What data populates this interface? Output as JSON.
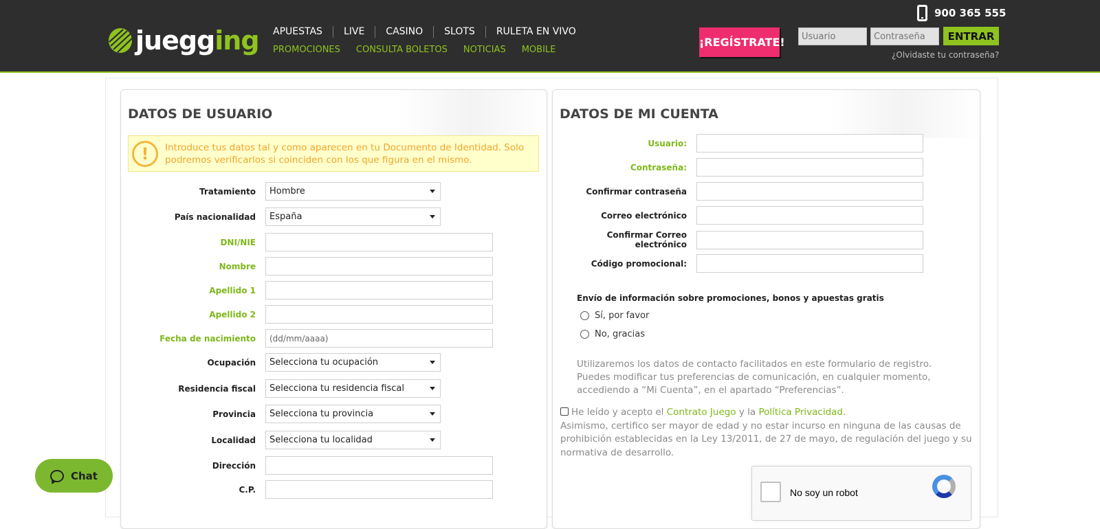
{
  "header": {
    "logo_text_start": "juegg",
    "logo_text_mid": "ing",
    "nav_main": [
      "APUESTAS",
      "LIVE",
      "CASINO",
      "SLOTS",
      "RULETA EN VIVO"
    ],
    "nav_sub": [
      "PROMOCIONES",
      "CONSULTA BOLETOS",
      "NOTICIAS",
      "MOBILE"
    ],
    "register_label": "¡REGÍSTRATE!",
    "phone": "900 365 555",
    "login_user_placeholder": "Usuario",
    "login_pass_placeholder": "Contraseña",
    "login_button": "ENTRAR",
    "forgot_password": "¿Olvidaste tu contraseña?"
  },
  "user_panel": {
    "title": "DATOS DE USUARIO",
    "notice": "Introduce tus datos tal y como aparecen en tu Documento de Identidad. Solo podremos verificarlos si coinciden con los que figura en el mismo.",
    "fields": {
      "treatment": {
        "label": "Tratamiento",
        "value": "Hombre"
      },
      "nationality": {
        "label": "País nacionalidad",
        "value": "España"
      },
      "dni": {
        "label": "DNI/NIE",
        "value": ""
      },
      "name": {
        "label": "Nombre",
        "value": ""
      },
      "surname1": {
        "label": "Apellido 1",
        "value": ""
      },
      "surname2": {
        "label": "Apellido 2",
        "value": ""
      },
      "birthdate": {
        "label": "Fecha de nacimiento",
        "placeholder": "(dd/mm/aaaa)"
      },
      "occupation": {
        "label": "Ocupación",
        "value": "Selecciona tu ocupación"
      },
      "tax_residence": {
        "label": "Residencia fiscal",
        "value": "Selecciona tu residencia fiscal"
      },
      "province": {
        "label": "Provincia",
        "value": "Selecciona tu provincia"
      },
      "locality": {
        "label": "Localidad",
        "value": "Selecciona tu localidad"
      },
      "address": {
        "label": "Dirección",
        "value": ""
      },
      "postcode": {
        "label": "C.P.",
        "value": ""
      }
    }
  },
  "account_panel": {
    "title": "DATOS DE MI CUENTA",
    "fields": {
      "username": {
        "label": "Usuario:",
        "value": ""
      },
      "password": {
        "label": "Contraseña:",
        "value": ""
      },
      "confirm_password": {
        "label": "Confirmar contraseña",
        "value": ""
      },
      "email": {
        "label": "Correo electrónico",
        "value": ""
      },
      "confirm_email": {
        "label": "Confirmar Correo electrónico",
        "value": ""
      },
      "promo_code": {
        "label": "Código promocional:",
        "value": ""
      }
    },
    "promo_question": "Envío de información sobre promociones, bonos y apuestas gratis",
    "radio_yes": "Sí, por favor",
    "radio_no": "No, gracias",
    "info_text": "Utilizaremos los datos de contacto facilitados en este formulario de registro. Puedes modificar tus preferencias de comunicación, en cualquier momento, accediendo a “Mi Cuenta”, en el apartado “Preferencias”.",
    "terms_prefix": "He leído y acepto el ",
    "terms_link1": "Contrato Juego",
    "terms_mid": " y la ",
    "terms_link2": "Política Privacidad",
    "terms_suffix": ".",
    "terms_note": "Asimismo, certifico ser mayor de edad y no estar incurso en ninguna de las causas de prohibición establecidas en la Ley 13/2011, de 27 de mayo, de regulación del juego y su normativa de desarrollo.",
    "recaptcha_label": "No soy un robot"
  },
  "chat": {
    "label": "Chat"
  },
  "colors": {
    "brand_green": "#8fc31f",
    "register_pink": "#ee2d6e",
    "header_bg": "#2e2e2e",
    "notice_yellow": "#ffffcc"
  }
}
